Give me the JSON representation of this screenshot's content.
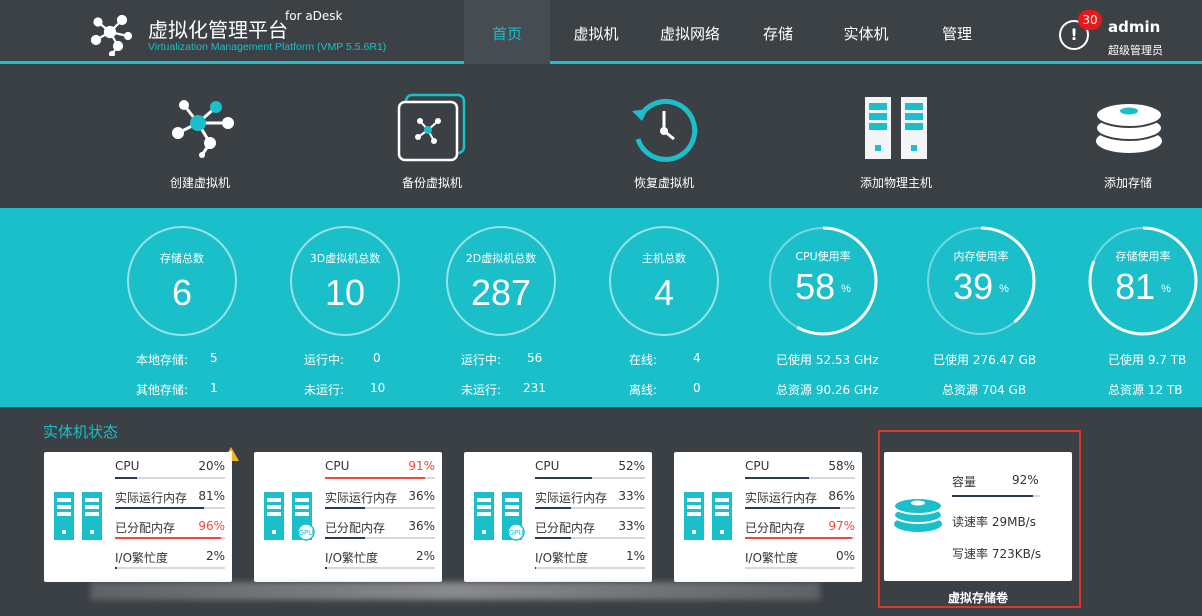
{
  "header": {
    "title": "虚拟化管理平台",
    "for_label": "for aDesk",
    "subtitle": "Virtualization Management Platform (VMP 5.5.6R1)",
    "nav": [
      {
        "label": "首页",
        "active": true
      },
      {
        "label": "虚拟机"
      },
      {
        "label": "虚拟网络"
      },
      {
        "label": "存储"
      },
      {
        "label": "实体机"
      },
      {
        "label": "管理"
      }
    ],
    "alert_icon": "exclamation-icon",
    "alert_count": "30",
    "user": {
      "name": "admin",
      "role": "超级管理员"
    }
  },
  "actions": [
    {
      "label": "创建虚拟机",
      "icon": "molecule-icon"
    },
    {
      "label": "备份虚拟机",
      "icon": "backup-icon"
    },
    {
      "label": "恢复虚拟机",
      "icon": "restore-clock-icon"
    },
    {
      "label": "添加物理主机",
      "icon": "server-icon"
    },
    {
      "label": "添加存储",
      "icon": "disk-stack-icon"
    }
  ],
  "stats": [
    {
      "title": "存储总数",
      "value": "6",
      "lines": [
        {
          "label": "本地存储:",
          "value": "5"
        },
        {
          "label": "其他存储:",
          "value": "1"
        }
      ]
    },
    {
      "title": "3D虚拟机总数",
      "value": "10",
      "lines": [
        {
          "label": "运行中:",
          "value": "0"
        },
        {
          "label": "未运行:",
          "value": "10"
        }
      ]
    },
    {
      "title": "2D虚拟机总数",
      "value": "287",
      "lines": [
        {
          "label": "运行中:",
          "value": "56"
        },
        {
          "label": "未运行:",
          "value": "231"
        }
      ]
    },
    {
      "title": "主机总数",
      "value": "4",
      "lines": [
        {
          "label": "在线:",
          "value": "4"
        },
        {
          "label": "离线:",
          "value": "0"
        }
      ]
    },
    {
      "title": "CPU使用率",
      "value": "58",
      "unit": "%",
      "percent": 58,
      "lines": [
        {
          "text": "已使用 52.53 GHz"
        },
        {
          "text": "总资源 90.26 GHz"
        }
      ]
    },
    {
      "title": "内存使用率",
      "value": "39",
      "unit": "%",
      "percent": 39,
      "lines": [
        {
          "text": "已使用 276.47 GB"
        },
        {
          "text": "总资源 704 GB"
        }
      ]
    },
    {
      "title": "存储使用率",
      "value": "81",
      "unit": "%",
      "percent": 81,
      "lines": [
        {
          "text": "已使用 9.7 TB"
        },
        {
          "text": "总资源 12 TB"
        }
      ]
    }
  ],
  "hosts_section": {
    "title": "实体机状态"
  },
  "hosts": [
    {
      "gpu": false,
      "warning": true,
      "metrics": [
        {
          "label": "CPU",
          "value": "20%",
          "percent": 20
        },
        {
          "label": "实际运行内存",
          "value": "81%",
          "percent": 81
        },
        {
          "label": "已分配内存",
          "value": "96%",
          "percent": 96,
          "warn": true
        },
        {
          "label": "I/O繁忙度",
          "value": "2%",
          "percent": 2
        }
      ]
    },
    {
      "gpu": true,
      "metrics": [
        {
          "label": "CPU",
          "value": "91%",
          "percent": 91,
          "warn": true
        },
        {
          "label": "实际运行内存",
          "value": "36%",
          "percent": 36
        },
        {
          "label": "已分配内存",
          "value": "36%",
          "percent": 36
        },
        {
          "label": "I/O繁忙度",
          "value": "2%",
          "percent": 2
        }
      ]
    },
    {
      "gpu": true,
      "metrics": [
        {
          "label": "CPU",
          "value": "52%",
          "percent": 52
        },
        {
          "label": "实际运行内存",
          "value": "33%",
          "percent": 33
        },
        {
          "label": "已分配内存",
          "value": "33%",
          "percent": 33
        },
        {
          "label": "I/O繁忙度",
          "value": "1%",
          "percent": 1
        }
      ]
    },
    {
      "gpu": false,
      "metrics": [
        {
          "label": "CPU",
          "value": "58%",
          "percent": 58
        },
        {
          "label": "实际运行内存",
          "value": "86%",
          "percent": 86
        },
        {
          "label": "已分配内存",
          "value": "97%",
          "percent": 97,
          "warn": true
        },
        {
          "label": "I/O繁忙度",
          "value": "0%",
          "percent": 0
        }
      ]
    }
  ],
  "gpu_tag": "GPU",
  "storage": {
    "label": "虚拟存储卷",
    "capacity_label": "容量",
    "capacity_value": "92%",
    "capacity_percent": 92,
    "read": "读速率 29MB/s",
    "write": "写速率 723KB/s"
  },
  "colors": {
    "accent": "#1bbfc9",
    "bg": "#3b4045",
    "warn": "#f0493e",
    "alert": "#e5191c"
  }
}
